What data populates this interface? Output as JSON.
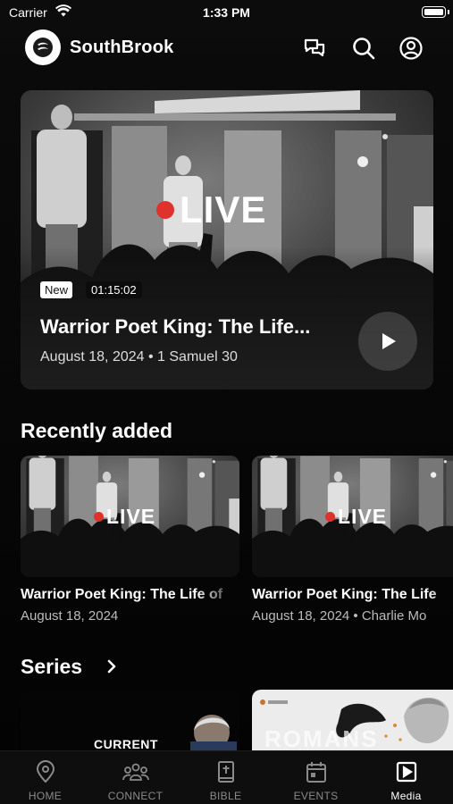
{
  "status_bar": {
    "carrier": "Carrier",
    "time": "1:33 PM",
    "battery_level": 1.0
  },
  "header": {
    "brand_name": "SouthBrook",
    "icons": [
      "chat-icon",
      "search-icon",
      "profile-icon"
    ]
  },
  "hero": {
    "live_label": "LIVE",
    "badge_new": "New",
    "duration": "01:15:02",
    "title": "Warrior Poet King: The Life...",
    "meta": "August 18, 2024 • 1 Samuel 30"
  },
  "recently_added": {
    "title": "Recently added",
    "items": [
      {
        "live_label": "LIVE",
        "title": "Warrior Poet King: The Life of",
        "meta": "August 18, 2024"
      },
      {
        "live_label": "LIVE",
        "title": "Warrior Poet King: The Life",
        "meta": "August 18, 2024 • Charlie Mo"
      }
    ]
  },
  "series": {
    "title": "Series",
    "current_label": "CURRENT",
    "romans_label": "ROMANS"
  },
  "tab_bar": {
    "active": "Media",
    "tabs": [
      {
        "label": "HOME",
        "icon": "location-pin-icon"
      },
      {
        "label": "CONNECT",
        "icon": "people-icon"
      },
      {
        "label": "BIBLE",
        "icon": "bible-icon"
      },
      {
        "label": "EVENTS",
        "icon": "calendar-icon"
      },
      {
        "label": "Media",
        "icon": "play-square-icon"
      }
    ]
  },
  "colors": {
    "background": "#000000",
    "live_dot": "#e0322d",
    "inactive_tab": "#8a8a8a"
  }
}
